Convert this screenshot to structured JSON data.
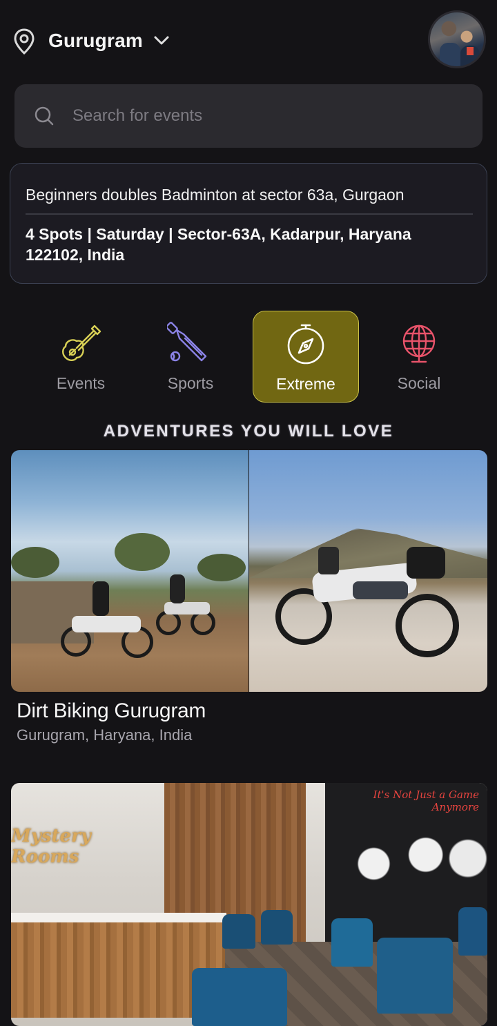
{
  "header": {
    "location": "Gurugram",
    "location_icon": "map-pin-icon",
    "dropdown_icon": "chevron-down-icon"
  },
  "search": {
    "placeholder": "Search for events",
    "value": ""
  },
  "upcoming_event": {
    "title": "Beginners doubles Badminton at sector 63a, Gurgaon",
    "details": "4 Spots | Saturday | Sector-63A, Kadarpur, Haryana 122102, India"
  },
  "categories": [
    {
      "label": "Events",
      "icon": "guitar-icon",
      "color": "#d7cf55",
      "active": false
    },
    {
      "label": "Sports",
      "icon": "cricket-bat-icon",
      "color": "#8b83e6",
      "active": false
    },
    {
      "label": "Extreme",
      "icon": "compass-icon",
      "color": "#ffffff",
      "active": true
    },
    {
      "label": "Social",
      "icon": "globe-icon",
      "color": "#e8536a",
      "active": false
    }
  ],
  "section_title": "ADVENTURES YOU WILL LOVE",
  "adventures": [
    {
      "title": "Dirt Biking Gurugram",
      "location": "Gurugram, Haryana, India"
    },
    {
      "sign_text": "Mystery Rooms",
      "mural_text": "It's Not Just a Game Anymore"
    }
  ],
  "colors": {
    "background": "#141316",
    "active_category": "#716712",
    "active_border": "#c9c048"
  }
}
